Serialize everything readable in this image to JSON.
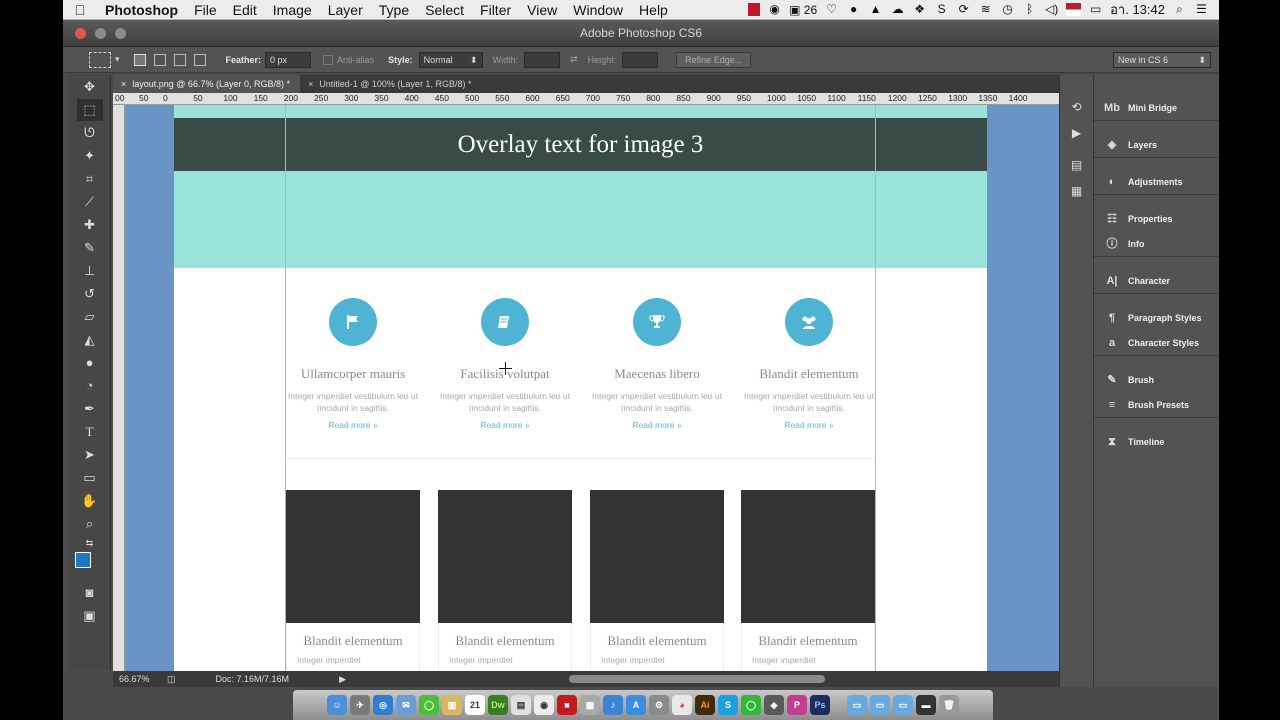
{
  "menubar": {
    "app_name": "Photoshop",
    "items": [
      "File",
      "Edit",
      "Image",
      "Layer",
      "Type",
      "Select",
      "Filter",
      "View",
      "Window",
      "Help"
    ],
    "battery_count": "26",
    "clock": "อา. 13:42"
  },
  "window": {
    "title": "Adobe Photoshop CS6"
  },
  "options": {
    "feather_label": "Feather:",
    "feather_value": "0 px",
    "antialias_label": "Anti-alias",
    "style_label": "Style:",
    "style_value": "Normal",
    "width_label": "Width:",
    "height_label": "Height:",
    "refine_edge": "Refine Edge...",
    "workspace": "New in CS 6"
  },
  "tabs": [
    {
      "label": "layout.png @ 66.7% (Layer 0, RGB/8) *"
    },
    {
      "label": "Untitled-1 @ 100% (Layer 1, RGB/8) *"
    }
  ],
  "ruler_labels": [
    "00",
    "50",
    "0",
    "50",
    "100",
    "150",
    "200",
    "250",
    "300",
    "350",
    "400",
    "450",
    "500",
    "550",
    "600",
    "650",
    "700",
    "750",
    "800",
    "850",
    "900",
    "950",
    "1000",
    "1050",
    "1100",
    "1150",
    "1200",
    "1250",
    "1300",
    "1350",
    "1400"
  ],
  "canvas": {
    "overlay_text": "Overlay text for image 3",
    "features": [
      {
        "title": "Ullamcorper mauris",
        "desc": "Integer imperdiet vestibulum leo ut tincidunt in sagittis.",
        "more": "Read more »",
        "icon": "flag-icon"
      },
      {
        "title": "Facilisis volutpat",
        "desc": "Integer imperdiet vestibulum leo ut tincidunt in sagittis.",
        "more": "Read more »",
        "icon": "book-icon"
      },
      {
        "title": "Maecenas libero",
        "desc": "Integer imperdiet vestibulum leo ut tincidunt in sagittis.",
        "more": "Read more »",
        "icon": "trophy-icon"
      },
      {
        "title": "Blandit elementum",
        "desc": "Integer imperdiet vestibulum leo ut tincidunt in sagittis.",
        "more": "Read more »",
        "icon": "group-icon"
      }
    ],
    "cards": [
      {
        "title": "Blandit elementum",
        "desc": "Integer imperdiet"
      },
      {
        "title": "Blandit elementum",
        "desc": "Integer imperdiet"
      },
      {
        "title": "Blandit elementum",
        "desc": "Integer imperdiet"
      },
      {
        "title": "Blandit elementum",
        "desc": "Integer imperdiet"
      }
    ]
  },
  "status": {
    "zoom": "66.67%",
    "doc": "Doc: 7.16M/7.16M"
  },
  "panels": [
    {
      "label": "Mini Bridge",
      "icon": "mini-bridge-icon",
      "glyph": "Mb"
    },
    {
      "label": "Layers",
      "icon": "layers-icon",
      "glyph": "◈"
    },
    {
      "label": "Adjustments",
      "icon": "adjustments-icon",
      "glyph": "◐"
    },
    {
      "label": "Properties",
      "icon": "properties-icon",
      "glyph": "☷"
    },
    {
      "label": "Info",
      "icon": "info-icon",
      "glyph": "ⓘ"
    },
    {
      "label": "Character",
      "icon": "character-icon",
      "glyph": "A|"
    },
    {
      "label": "Paragraph Styles",
      "icon": "paragraph-styles-icon",
      "glyph": "¶"
    },
    {
      "label": "Character Styles",
      "icon": "character-styles-icon",
      "glyph": "a"
    },
    {
      "label": "Brush",
      "icon": "brush-icon",
      "glyph": "✎"
    },
    {
      "label": "Brush Presets",
      "icon": "brush-presets-icon",
      "glyph": "≡"
    },
    {
      "label": "Timeline",
      "icon": "timeline-icon",
      "glyph": "⧗"
    }
  ],
  "colors": {
    "accent_blue": "#4fb3d4",
    "teal": "#99e3da",
    "overlay": "#3a4a47",
    "canvas_bg": "#6a93c6"
  },
  "dock_apps": [
    {
      "glyph": "21",
      "color": "#e25b4b"
    },
    {
      "glyph": "Dw",
      "color": "#3b7d23"
    },
    {
      "glyph": "Ai",
      "color": "#3f2a10"
    },
    {
      "glyph": "Ps",
      "color": "#1c2e5e"
    }
  ]
}
